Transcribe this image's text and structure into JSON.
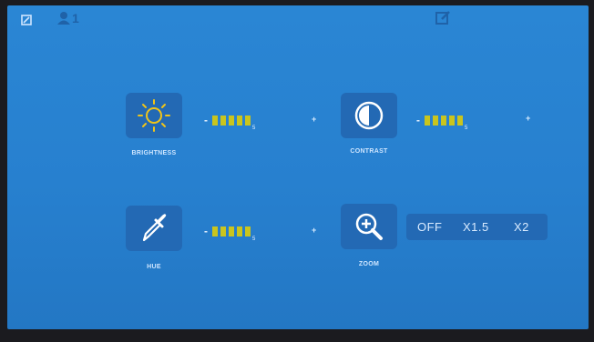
{
  "status_bar": {
    "icons": [
      "checkbox-icon",
      "person-icon",
      "edit-icon"
    ],
    "channel": "1"
  },
  "settings": {
    "brightness": {
      "label": "BRIGHTNESS",
      "value": "5",
      "minus": "-",
      "plus": "+"
    },
    "contrast": {
      "label": "CONTRAST",
      "value": "5",
      "minus": "-",
      "plus": "+"
    },
    "hue": {
      "label": "HUE",
      "value": "5",
      "minus": "-",
      "plus": "+"
    },
    "zoom": {
      "label": "ZOOM",
      "options": [
        "OFF",
        "X1.5",
        "X2"
      ]
    }
  },
  "colors": {
    "background": "#2780cf",
    "tile": "#2369b4",
    "bar": "#c9c51e",
    "icon": "#f0c419"
  }
}
